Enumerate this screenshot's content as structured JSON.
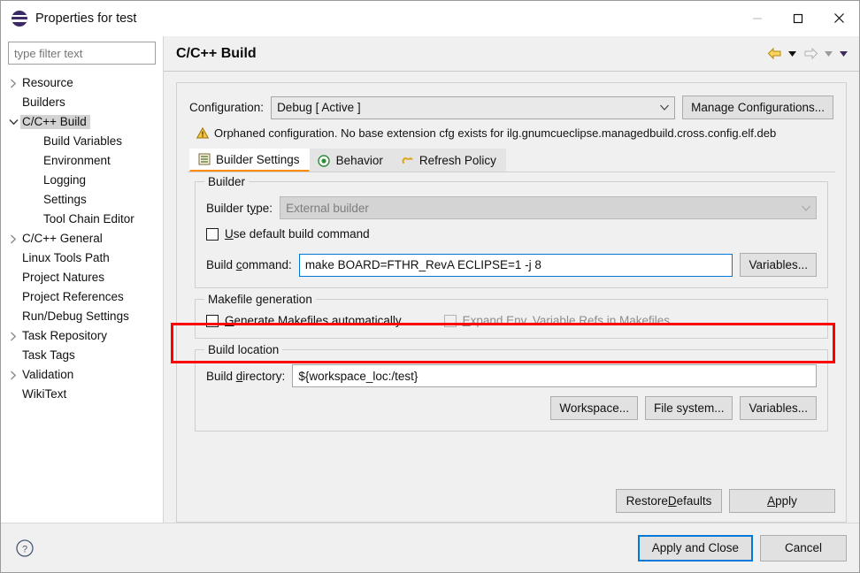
{
  "window": {
    "title": "Properties for test",
    "icon": "eclipse-icon",
    "minimize_label": "Minimize",
    "maximize_label": "Maximize",
    "close_label": "Close"
  },
  "sidebar": {
    "filter_placeholder": "type filter text",
    "filter_value": "",
    "items": [
      {
        "label": "Resource",
        "indent": 0,
        "arrow": "collapsed",
        "selected": false
      },
      {
        "label": "Builders",
        "indent": 0,
        "arrow": "none",
        "selected": false
      },
      {
        "label": "C/C++ Build",
        "indent": 0,
        "arrow": "expanded",
        "selected": true
      },
      {
        "label": "Build Variables",
        "indent": 1,
        "arrow": "none",
        "selected": false
      },
      {
        "label": "Environment",
        "indent": 1,
        "arrow": "none",
        "selected": false
      },
      {
        "label": "Logging",
        "indent": 1,
        "arrow": "none",
        "selected": false
      },
      {
        "label": "Settings",
        "indent": 1,
        "arrow": "none",
        "selected": false
      },
      {
        "label": "Tool Chain Editor",
        "indent": 1,
        "arrow": "none",
        "selected": false
      },
      {
        "label": "C/C++ General",
        "indent": 0,
        "arrow": "collapsed",
        "selected": false
      },
      {
        "label": "Linux Tools Path",
        "indent": 0,
        "arrow": "none",
        "selected": false
      },
      {
        "label": "Project Natures",
        "indent": 0,
        "arrow": "none",
        "selected": false
      },
      {
        "label": "Project References",
        "indent": 0,
        "arrow": "none",
        "selected": false
      },
      {
        "label": "Run/Debug Settings",
        "indent": 0,
        "arrow": "none",
        "selected": false
      },
      {
        "label": "Task Repository",
        "indent": 0,
        "arrow": "collapsed",
        "selected": false
      },
      {
        "label": "Task Tags",
        "indent": 0,
        "arrow": "none",
        "selected": false
      },
      {
        "label": "Validation",
        "indent": 0,
        "arrow": "collapsed",
        "selected": false
      },
      {
        "label": "WikiText",
        "indent": 0,
        "arrow": "none",
        "selected": false
      }
    ]
  },
  "page": {
    "title": "C/C++ Build",
    "nav": {
      "back_label": "Back",
      "back_menu_label": "Back history",
      "forward_label": "Forward",
      "forward_menu_label": "Forward history",
      "view_menu_label": "View menu"
    },
    "configuration": {
      "label": "Configuration:",
      "value": "Debug  [ Active ]",
      "manage_button": "Manage Configurations..."
    },
    "warning": {
      "icon": "warning-icon",
      "text": "Orphaned configuration. No base extension cfg exists for ilg.gnumcueclipse.managedbuild.cross.config.elf.deb"
    },
    "tabs": [
      {
        "label": "Builder Settings",
        "icon": "list-icon",
        "active": true
      },
      {
        "label": "Behavior",
        "icon": "radio-icon",
        "active": false
      },
      {
        "label": "Refresh Policy",
        "icon": "refresh-icon",
        "active": false
      }
    ],
    "builder_group": {
      "title": "Builder",
      "builder_type_label": "Builder type:",
      "builder_type_value": "External builder",
      "use_default_label": "Use default build command",
      "use_default_checked": false,
      "build_command_label": "Build command:",
      "build_command_value": "make BOARD=FTHR_RevA ECLIPSE=1 -j 8",
      "variables_button": "Variables..."
    },
    "makefile_group": {
      "title": "Makefile generation",
      "generate_label": "Generate Makefiles automatically",
      "generate_checked": false,
      "expand_label": "Expand Env. Variable Refs in Makefiles",
      "expand_checked": false
    },
    "build_location_group": {
      "title": "Build location",
      "build_directory_label": "Build directory:",
      "build_directory_value": "${workspace_loc:/test}",
      "workspace_button": "Workspace...",
      "filesystem_button": "File system...",
      "variables_button": "Variables..."
    },
    "panel_buttons": {
      "restore_defaults": "Restore Defaults",
      "apply": "Apply"
    }
  },
  "footer": {
    "help_icon": "help-icon",
    "apply_and_close": "Apply and Close",
    "cancel": "Cancel"
  },
  "colors": {
    "accent": "#0078d7",
    "annotation": "#ff0000",
    "tab_underline": "#ff8c00",
    "warning": "#e8a317"
  }
}
